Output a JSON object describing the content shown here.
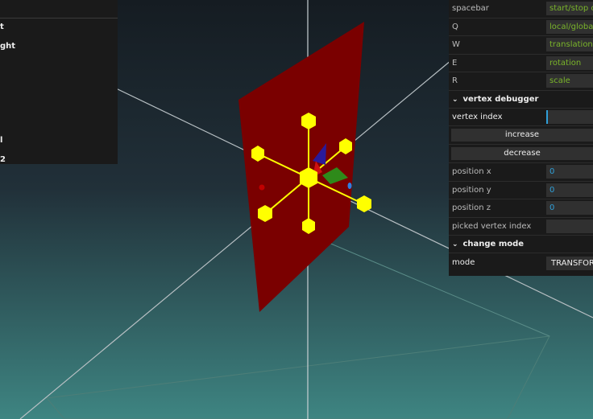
{
  "left_panel": {
    "items": [
      "t",
      "ght",
      "",
      "",
      "",
      "",
      "l",
      "2"
    ]
  },
  "right_panel": {
    "keys": [
      {
        "key": "spacebar",
        "action": "start/stop cl"
      },
      {
        "key": "Q",
        "action": "local/global"
      },
      {
        "key": "W",
        "action": "translation"
      },
      {
        "key": "E",
        "action": "rotation"
      },
      {
        "key": "R",
        "action": "scale"
      }
    ],
    "vertex_debugger": {
      "title": "vertex debugger",
      "vertex_index_label": "vertex index",
      "vertex_index_value": "",
      "increase_label": "increase",
      "decrease_label": "decrease",
      "position_x_label": "position x",
      "position_x_value": "0",
      "position_y_label": "position y",
      "position_y_value": "0",
      "position_z_label": "position z",
      "position_z_value": "0",
      "picked_label": "picked vertex index",
      "picked_value": ""
    },
    "change_mode": {
      "title": "change mode",
      "mode_label": "mode",
      "mode_value": "TRANSFORM"
    }
  },
  "colors": {
    "plane": "#7a0000",
    "handle": "#ffff00",
    "panel_bg": "#1a1a1a",
    "accent_green": "#7ab52a",
    "accent_blue": "#2f9fd8"
  },
  "icons": {
    "folder_toggle": "chevron-down-icon"
  }
}
